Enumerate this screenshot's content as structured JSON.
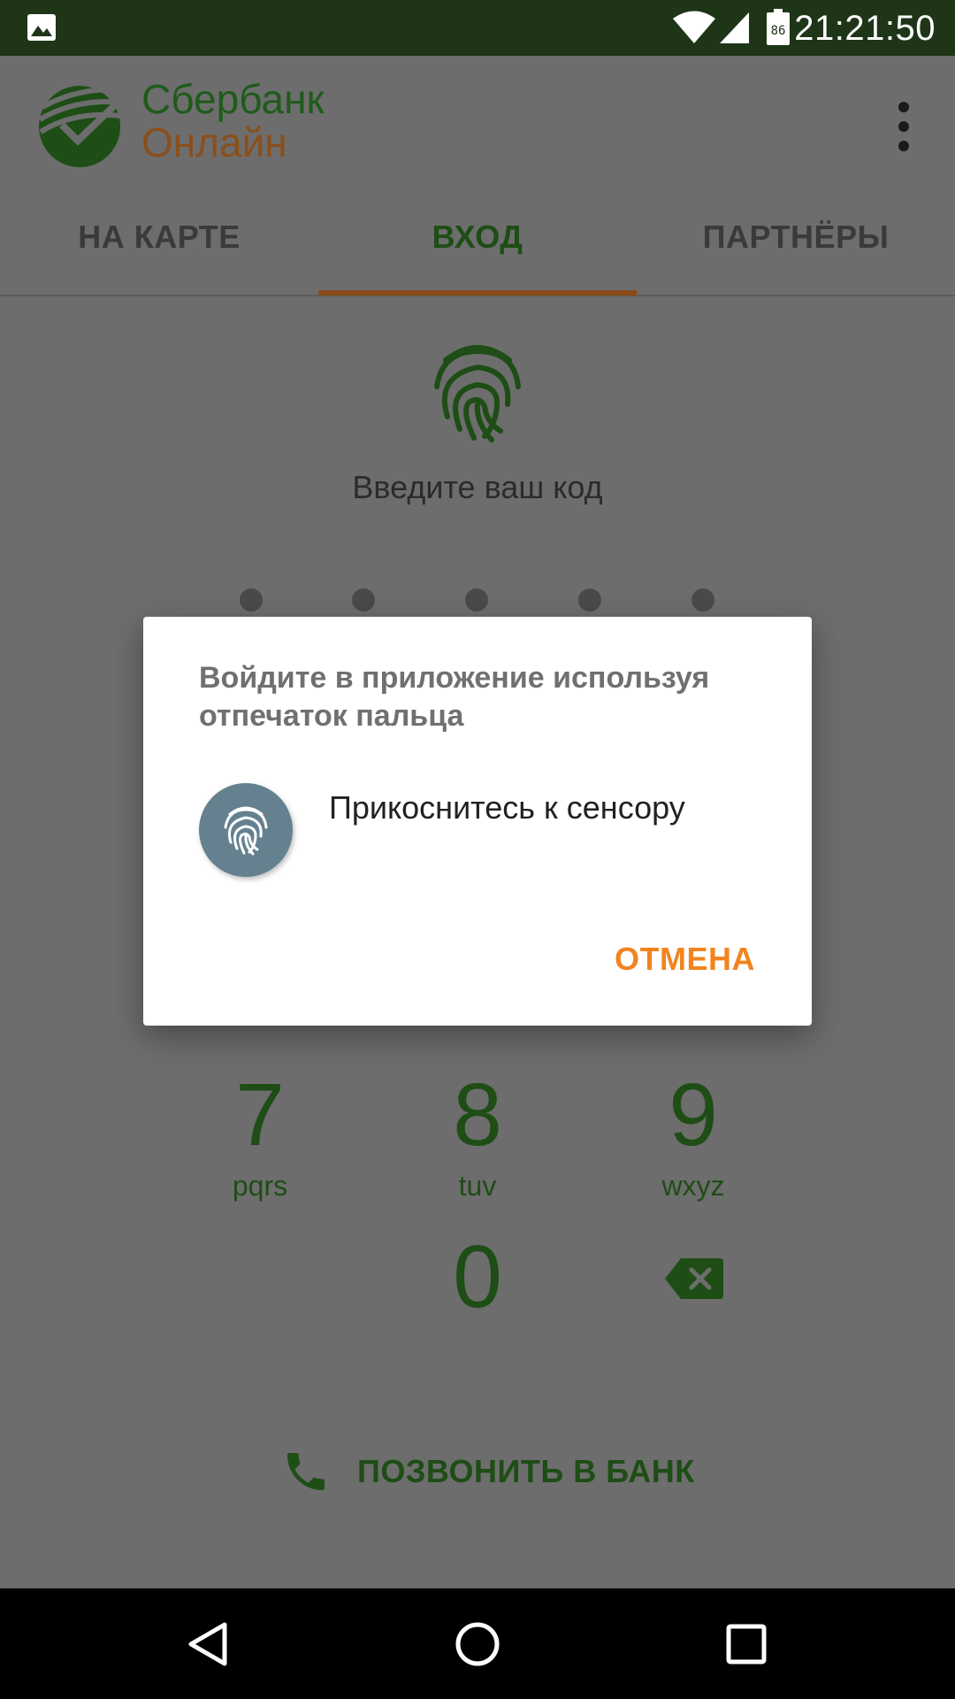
{
  "status_bar": {
    "time": "21:21:50",
    "battery_level": "86",
    "icons": [
      "image-notification-icon",
      "wifi-icon",
      "cell-signal-icon",
      "battery-icon"
    ]
  },
  "app": {
    "brand_line1": "Сбербанк",
    "brand_line2": "Онлайн",
    "colors": {
      "brand_green": "#1e4d16",
      "brand_orange": "#f2841e"
    }
  },
  "tabs": [
    {
      "label": "НА КАРТЕ",
      "active": false
    },
    {
      "label": "ВХОД",
      "active": true
    },
    {
      "label": "ПАРТНЁРЫ",
      "active": false
    }
  ],
  "login": {
    "prompt": "Введите ваш код",
    "pin_length": 5
  },
  "keypad": [
    {
      "digit": "7",
      "letters": "pqrs"
    },
    {
      "digit": "8",
      "letters": "tuv"
    },
    {
      "digit": "9",
      "letters": "wxyz"
    },
    {
      "digit": "0",
      "letters": ""
    }
  ],
  "call_bank": {
    "label": "ПОЗВОНИТЬ В БАНК"
  },
  "dialog": {
    "title": "Войдите в приложение используя отпечаток пальца",
    "hint": "Прикоснитесь к сенсору",
    "cancel_label": "ОТМЕНА"
  }
}
